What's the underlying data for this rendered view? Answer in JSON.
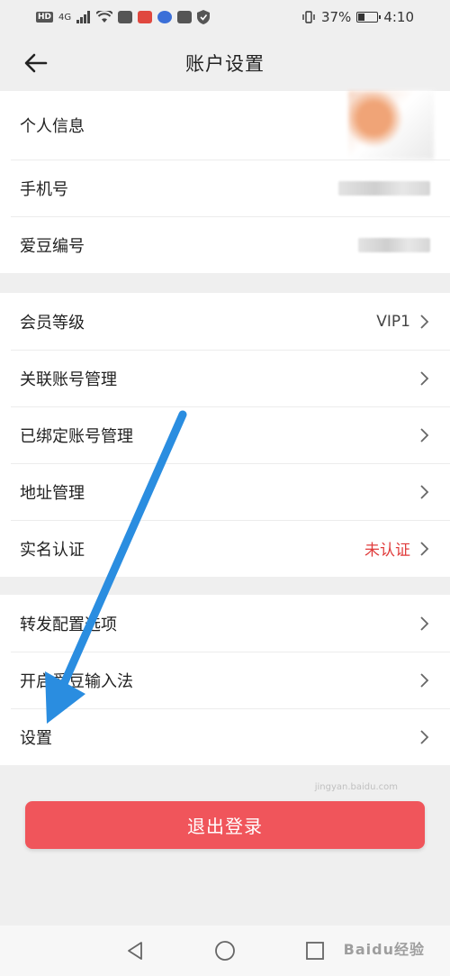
{
  "status_bar": {
    "battery_percent": "37%",
    "battery_level": 0.37,
    "time": "4:10",
    "network": "4G"
  },
  "header": {
    "title": "账户设置"
  },
  "profile_group": {
    "items": [
      {
        "label": "个人信息",
        "value": ""
      },
      {
        "label": "手机号",
        "value": ""
      },
      {
        "label": "爱豆编号",
        "value": ""
      }
    ]
  },
  "account_group": {
    "items": [
      {
        "label": "会员等级",
        "value": "VIP1"
      },
      {
        "label": "关联账号管理",
        "value": ""
      },
      {
        "label": "已绑定账号管理",
        "value": ""
      },
      {
        "label": "地址管理",
        "value": ""
      },
      {
        "label": "实名认证",
        "value": "未认证"
      }
    ]
  },
  "settings_group": {
    "items": [
      {
        "label": "转发配置选项",
        "value": ""
      },
      {
        "label": "开启爱豆输入法",
        "value": ""
      },
      {
        "label": "设置",
        "value": ""
      }
    ]
  },
  "logout": {
    "label": "退出登录"
  },
  "watermark": {
    "text": "Baidu经验",
    "sub": "jingyan.baidu.com"
  },
  "colors": {
    "accent_red": "#f0555b",
    "status_red": "#e03c3c",
    "annotation_blue": "#2a8de0"
  }
}
